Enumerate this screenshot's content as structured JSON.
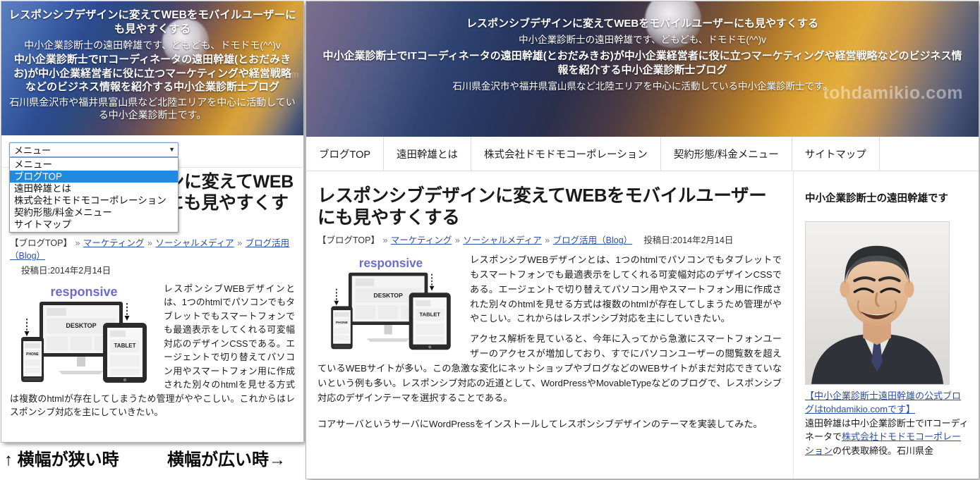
{
  "site": {
    "hero": {
      "title": "レスポンシブデザインに変えてWEBをモバイルユーザーにも見やすくする",
      "subtitle": "中小企業診断士の遠田幹雄です、どもども、ドモドモ(^^)v",
      "description": "中小企業診断士でITコーディネータの遠田幹雄(とおだみきお)が中小企業経営者に役に立つマーケティングや経営戦略などのビジネス情報を紹介する中小企業診断士ブログ",
      "footer": "石川県金沢市や福井県富山県など北陸エリアを中心に活動している中小企業診断士です。",
      "watermark": "tohdamikio.com"
    },
    "nav": {
      "items": [
        "ブログTOP",
        "遠田幹雄とは",
        "株式会社ドモドモコーポレーション",
        "契約形態/料金メニュー",
        "サイトマップ"
      ]
    },
    "select": {
      "value": "メニュー",
      "caret": "▼",
      "options": [
        "メニュー",
        "ブログTOP",
        "遠田幹雄とは",
        "株式会社ドモドモコーポレーション",
        "契約形態/料金メニュー",
        "サイトマップ"
      ],
      "selected_index": 1
    },
    "article": {
      "title": "レスポンシブデザインに変えてWEBをモバイルユーザーにも見やすくする",
      "breadcrumb": {
        "home": "【ブログTOP】",
        "sep": "»",
        "items": [
          "マーケティング",
          "ソーシャルメディア",
          "ブログ活用（Blog）"
        ]
      },
      "posted": "投稿日:2014年2月14日",
      "figure": {
        "caption": "responsive",
        "labels": {
          "desktop": "DESKTOP",
          "tablet": "TABLET",
          "phone": "PHONE"
        }
      },
      "paragraph1": "レスポンシブWEBデザインとは、1つのhtmlでパソコンでもタブレットでもスマートフォンでも最適表示をしてくれる可変幅対応のデザインCSSである。エージェントで切り替えてパソコン用やスマートフォン用に作成された別々のhtmlを見せる方式は複数のhtmlが存在してしまうため管理がややこしい。これからはレスポンシブ対応を主にしていきたい。",
      "paragraph2": "アクセス解析を見ていると、今年に入ってから急激にスマートフォンユーザーのアクセスが増加しており、すでにパソコンユーザーの閲覧数を超えているWEBサイトが多い。この急激な変化にネットショップやブログなどのWEBサイトがまだ対応できていないという例も多い。レスポンシブ対応の近道として、WordPressやMovableTypeなどのブログで、レスポンシブ対応のデザインテーマを選択することである。",
      "paragraph3": "コアサーバというサーバにWordPressをインストールしてレスポンシブデザインのテーマを実装してみた。"
    },
    "sidebar": {
      "heading": "中小企業診断士の遠田幹雄です",
      "photo_alt": "遠田幹雄の顔写真",
      "link_text": "【中小企業診断士遠田幹雄の公式ブログはtohdamikio.comです】",
      "body_before": "遠田幹雄は中小企業診断士でITコーディネータで",
      "body_link": "株式会社ドモドモコーポレーション",
      "body_after": "の代表取締役。石川県金"
    }
  },
  "captions": {
    "narrow": "↑ 横幅が狭い時",
    "wide": "横幅が広い時→"
  },
  "colors": {
    "select_highlight": "#1f8ae0",
    "link": "#2a4fa0",
    "hero_blue": "#2c4a90",
    "hero_amber": "#d9a33a"
  }
}
